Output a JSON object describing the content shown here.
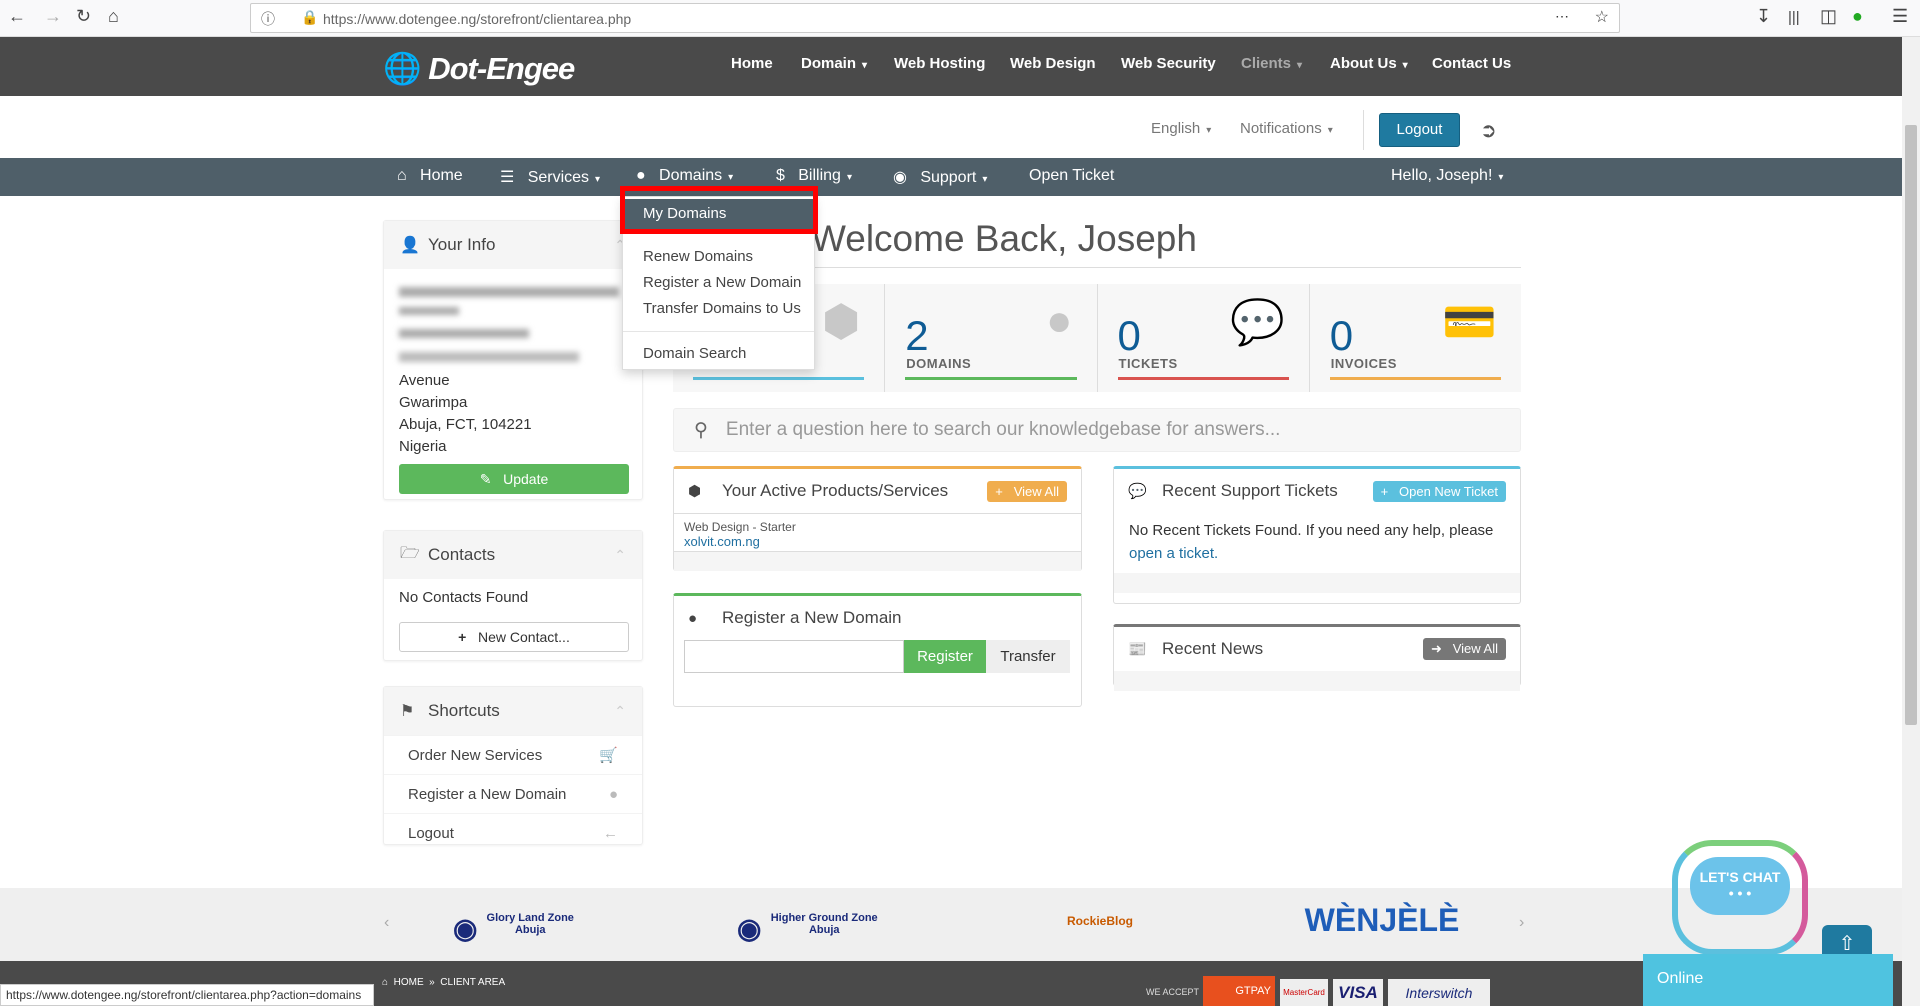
{
  "browser": {
    "url": "https://www.dotengee.ng/storefront/clientarea.php",
    "status_url": "https://www.dotengee.ng/storefront/clientarea.php?action=domains"
  },
  "header": {
    "logo": "Dot-Engee",
    "nav": [
      "Home",
      "Domain",
      "Web Hosting",
      "Web Design",
      "Web Security",
      "Clients",
      "About Us",
      "Contact Us"
    ]
  },
  "subheader": {
    "language": "English",
    "notifications": "Notifications",
    "logout": "Logout"
  },
  "navbar": {
    "home": "Home",
    "services": "Services",
    "domains": "Domains",
    "billing": "Billing",
    "support": "Support",
    "open_ticket": "Open Ticket",
    "user": "Hello, Joseph!"
  },
  "dropdown": {
    "items": [
      "My Domains",
      "Renew Domains",
      "Register a New Domain",
      "Transfer Domains to Us",
      "Domain Search"
    ]
  },
  "sidebar": {
    "your_info": {
      "title": "Your Info",
      "address": [
        "Avenue",
        "Gwarimpa",
        "Abuja, FCT, 104221",
        "Nigeria"
      ],
      "update": "Update"
    },
    "contacts": {
      "title": "Contacts",
      "empty": "No Contacts Found",
      "new": "New Contact..."
    },
    "shortcuts": {
      "title": "Shortcuts",
      "items": [
        "Order New Services",
        "Register a New Domain",
        "Logout"
      ]
    }
  },
  "main": {
    "welcome": "Welcome Back, Joseph",
    "stats": [
      {
        "value": "2",
        "label": "DOMAINS"
      },
      {
        "value": "0",
        "label": "TICKETS"
      },
      {
        "value": "0",
        "label": "INVOICES"
      }
    ],
    "search_placeholder": "Enter a question here to search our knowledgebase for answers...",
    "products": {
      "title": "Your Active Products/Services",
      "view_all": "View All",
      "item_name": "Web Design - Starter",
      "item_domain": "xolvit.com.ng"
    },
    "register": {
      "title": "Register a New Domain",
      "register": "Register",
      "transfer": "Transfer"
    },
    "tickets": {
      "title": "Recent Support Tickets",
      "open_new": "Open New Ticket",
      "empty": "No Recent Tickets Found. If you need any help, please",
      "link": "open a ticket."
    },
    "news": {
      "title": "Recent News",
      "view_all": "View All"
    }
  },
  "footer": {
    "logos": [
      "Glory Land Zone Abuja",
      "Higher Ground Zone Abuja",
      "RockieBlog",
      "WÈNJÈLÈ"
    ],
    "breadcrumb": [
      "HOME",
      "CLIENT AREA"
    ],
    "we_accept": "WE ACCEPT",
    "payments": [
      "GTPAY",
      "MasterCard",
      "VISA",
      "Interswitch"
    ]
  },
  "chat": {
    "label": "LET'S CHAT",
    "status": "Online"
  },
  "colors": {
    "navbar": "#4f5f69",
    "header": "#4a4a4a",
    "accent": "#1f7aa0",
    "green": "#5cb85c",
    "orange": "#f0ad4e",
    "blue": "#5bc0de",
    "red": "#d9534f"
  }
}
